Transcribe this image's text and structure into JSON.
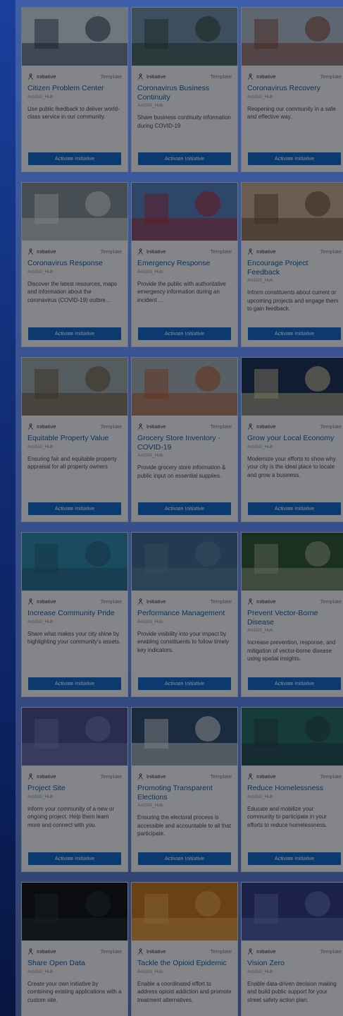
{
  "cards": [
    {
      "kind": "Initiative",
      "tag": "Template",
      "title": "Citizen Problem Center",
      "owner": "ArcGIS_Hub",
      "description": "Use public feedback to deliver world-class service in our community.",
      "button": "Activate Initiative"
    },
    {
      "kind": "Initiative",
      "tag": "Template",
      "title": "Coronavirus Business Continuity",
      "owner": "ArcGIS_Hub",
      "description": "Share business continuity information during COVID-19",
      "button": "Activate Initiative"
    },
    {
      "kind": "Initiative",
      "tag": "Template",
      "title": "Coronavirus Recovery",
      "owner": "ArcGIS_Hub",
      "description": "Reopening our community in a safe and effective way.",
      "button": "Activate Initiative"
    },
    {
      "kind": "Initiative",
      "tag": "Template",
      "title": "Coronavirus Response",
      "owner": "ArcGIS_Hub",
      "description": "Discover the latest resources, maps and information about the coronavirus (COVID-19) outbre...",
      "button": "Activate Initiative"
    },
    {
      "kind": "Initiative",
      "tag": "Template",
      "title": "Emergency Response",
      "owner": "ArcGIS_Hub",
      "description": "Provide the public with authoritative emergency information during an incident ...",
      "button": "Activate Initiative"
    },
    {
      "kind": "Initiative",
      "tag": "Template",
      "title": "Encourage Project Feedback",
      "owner": "ArcGIS_Hub",
      "description": "Inform constituents about current or upcoming projects and engage them to gain feedback.",
      "button": "Activate Initiative"
    },
    {
      "kind": "Initiative",
      "tag": "Template",
      "title": "Equitable Property Value",
      "owner": "ArcGIS_Hub",
      "description": "Ensuring fair and equitable property appraisal for all property owners",
      "button": "Activate Initiative"
    },
    {
      "kind": "Initiative",
      "tag": "Template",
      "title": "Grocery Store Inventory - COVID-19",
      "owner": "ArcGIS_Hub",
      "description": "Provide grocery store information & public input on essential supplies.",
      "button": "Activate Initiative"
    },
    {
      "kind": "Initiative",
      "tag": "Template",
      "title": "Grow your Local Economy",
      "owner": "ArcGIS_Hub",
      "description": "Modernize your efforts to show why your city is the ideal place to locate and grow a business.",
      "button": "Activate Initiative"
    },
    {
      "kind": "Initiative",
      "tag": "Template",
      "title": "Increase Community Pride",
      "owner": "ArcGIS_Hub",
      "description": "Share what makes your city shine by highlighting your community's assets.",
      "button": "Activate Initiative"
    },
    {
      "kind": "Initiative",
      "tag": "Template",
      "title": "Performance Management",
      "owner": "ArcGIS_Hub",
      "description": "Provide visibility into your impact by enabling constituents to follow timely key indicators.",
      "button": "Activate Initiative"
    },
    {
      "kind": "Initiative",
      "tag": "Template",
      "title": "Prevent Vector-Borne Disease",
      "owner": "ArcGIS_Hub",
      "description": "Increase prevention, response, and mitigation of vector-borne disease using spatial insights.",
      "button": "Activate Initiative"
    },
    {
      "kind": "Initiative",
      "tag": "Template",
      "title": "Project Site",
      "owner": "ArcGIS_Hub",
      "description": "Inform your community of a new or ongoing project. Help them learn more and connect with you.",
      "button": "Activate Initiative"
    },
    {
      "kind": "Initiative",
      "tag": "Template",
      "title": "Promoting Transparent Elections",
      "owner": "ArcGIS_Hub",
      "description": "Ensuring the electoral process is accessible and accountable to all that participate.",
      "button": "Activate Initiative"
    },
    {
      "kind": "Initiative",
      "tag": "Template",
      "title": "Reduce Homelessness",
      "owner": "ArcGIS_Hub",
      "description": "Educate and mobilize your community to participate in your efforts to reduce homelessness.",
      "button": "Activate Initiative"
    },
    {
      "kind": "Initiative",
      "tag": "Template",
      "title": "Share Open Data",
      "owner": "ArcGIS_Hub",
      "description": "Create your own initiative by combining existing applications with a custom site.",
      "button": "Activate Initiative"
    },
    {
      "kind": "Initiative",
      "tag": "Template",
      "title": "Tackle the Opioid Epidemic",
      "owner": "ArcGIS_Hub",
      "description": "Enable a coordinated effort to address opioid addiction and promote treatment alternatives.",
      "button": "Activate Initiative"
    },
    {
      "kind": "Initiative",
      "tag": "Template",
      "title": "Vision Zero",
      "owner": "ArcGIS_Hub",
      "description": "Enable data-driven decision making and build public support for your street safety action plan.",
      "button": "Activate Initiative"
    }
  ],
  "thumbs": [
    {
      "icon": "hand-writing-photo-icon",
      "bg": "#c9d6e6",
      "fg": "#2a3e5c"
    },
    {
      "icon": "city-skyline-photo-icon",
      "bg": "#6c8fb1",
      "fg": "#2d4a35"
    },
    {
      "icon": "street-storefront-photo-icon",
      "bg": "#a8b9cf",
      "fg": "#8c4a3a"
    },
    {
      "icon": "hospital-hallway-photo-icon",
      "bg": "#7f8f98",
      "fg": "#e6e6e6"
    },
    {
      "icon": "ambulance-photo-icon",
      "bg": "#4f7fc4",
      "fg": "#c4283a"
    },
    {
      "icon": "blueprint-desk-photo-icon",
      "bg": "#c7a98e",
      "fg": "#6a4f3a"
    },
    {
      "icon": "aerial-houses-photo-icon",
      "bg": "#9aa7ad",
      "fg": "#6c5a3a"
    },
    {
      "icon": "grocery-aisle-photo-icon",
      "bg": "#9eaeb8",
      "fg": "#c45a2a"
    },
    {
      "icon": "night-city-photo-icon",
      "bg": "#18345e",
      "fg": "#e4d6a1"
    },
    {
      "icon": "aerial-city-blue-photo-icon",
      "bg": "#2a8ab6",
      "fg": "#1f5f82"
    },
    {
      "icon": "crowd-street-photo-icon",
      "bg": "#3c6b99",
      "fg": "#5a86ab"
    },
    {
      "icon": "green-canal-photo-icon",
      "bg": "#2d5a38",
      "fg": "#a7b5a0"
    },
    {
      "icon": "satellite-map-photo-icon",
      "bg": "#4a4d9a",
      "fg": "#7a83c6"
    },
    {
      "icon": "voting-booth-photo-icon",
      "bg": "#2c4f7a",
      "fg": "#eaeaea"
    },
    {
      "icon": "teal-tent-photo-icon",
      "bg": "#1f6f6d",
      "fg": "#2a3f52"
    },
    {
      "icon": "dark-data-photo-icon",
      "bg": "#12161c",
      "fg": "#2b3540"
    },
    {
      "icon": "pills-photo-icon",
      "bg": "#c8741e",
      "fg": "#f2b14a"
    },
    {
      "icon": "city-street-photo-icon",
      "bg": "#2f3c8c",
      "fg": "#6a7bd0"
    }
  ]
}
